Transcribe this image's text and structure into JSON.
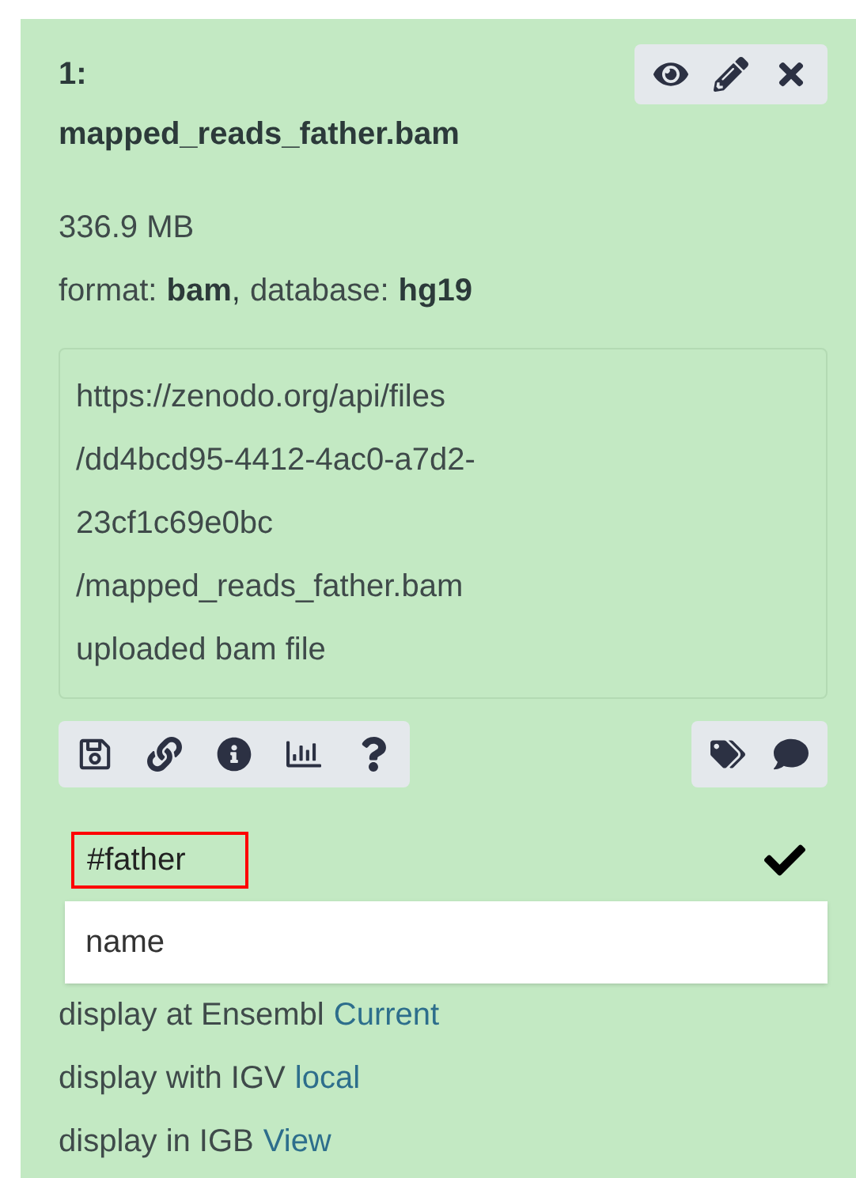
{
  "dataset": {
    "title": "1: mapped_reads_father.bam",
    "size": "336.9 MB",
    "format_label": "format:",
    "format": "bam",
    "separator": ",",
    "database_label": "database:",
    "database": "hg19",
    "description": {
      "url": "https://zenodo.org/api/files/dd4bcd95-4412-4ac0-a7d2-23cf1c69e0bc/mapped_reads_father.bam",
      "info": "uploaded bam file"
    },
    "tag_input": {
      "value": "#father"
    },
    "autocomplete": [
      {
        "label": "name"
      }
    ],
    "display_links": [
      {
        "text": "display at Ensembl",
        "link": "Current"
      },
      {
        "text": "display with IGV",
        "link": "local"
      },
      {
        "text": "display in IGB",
        "link": "View"
      }
    ]
  }
}
